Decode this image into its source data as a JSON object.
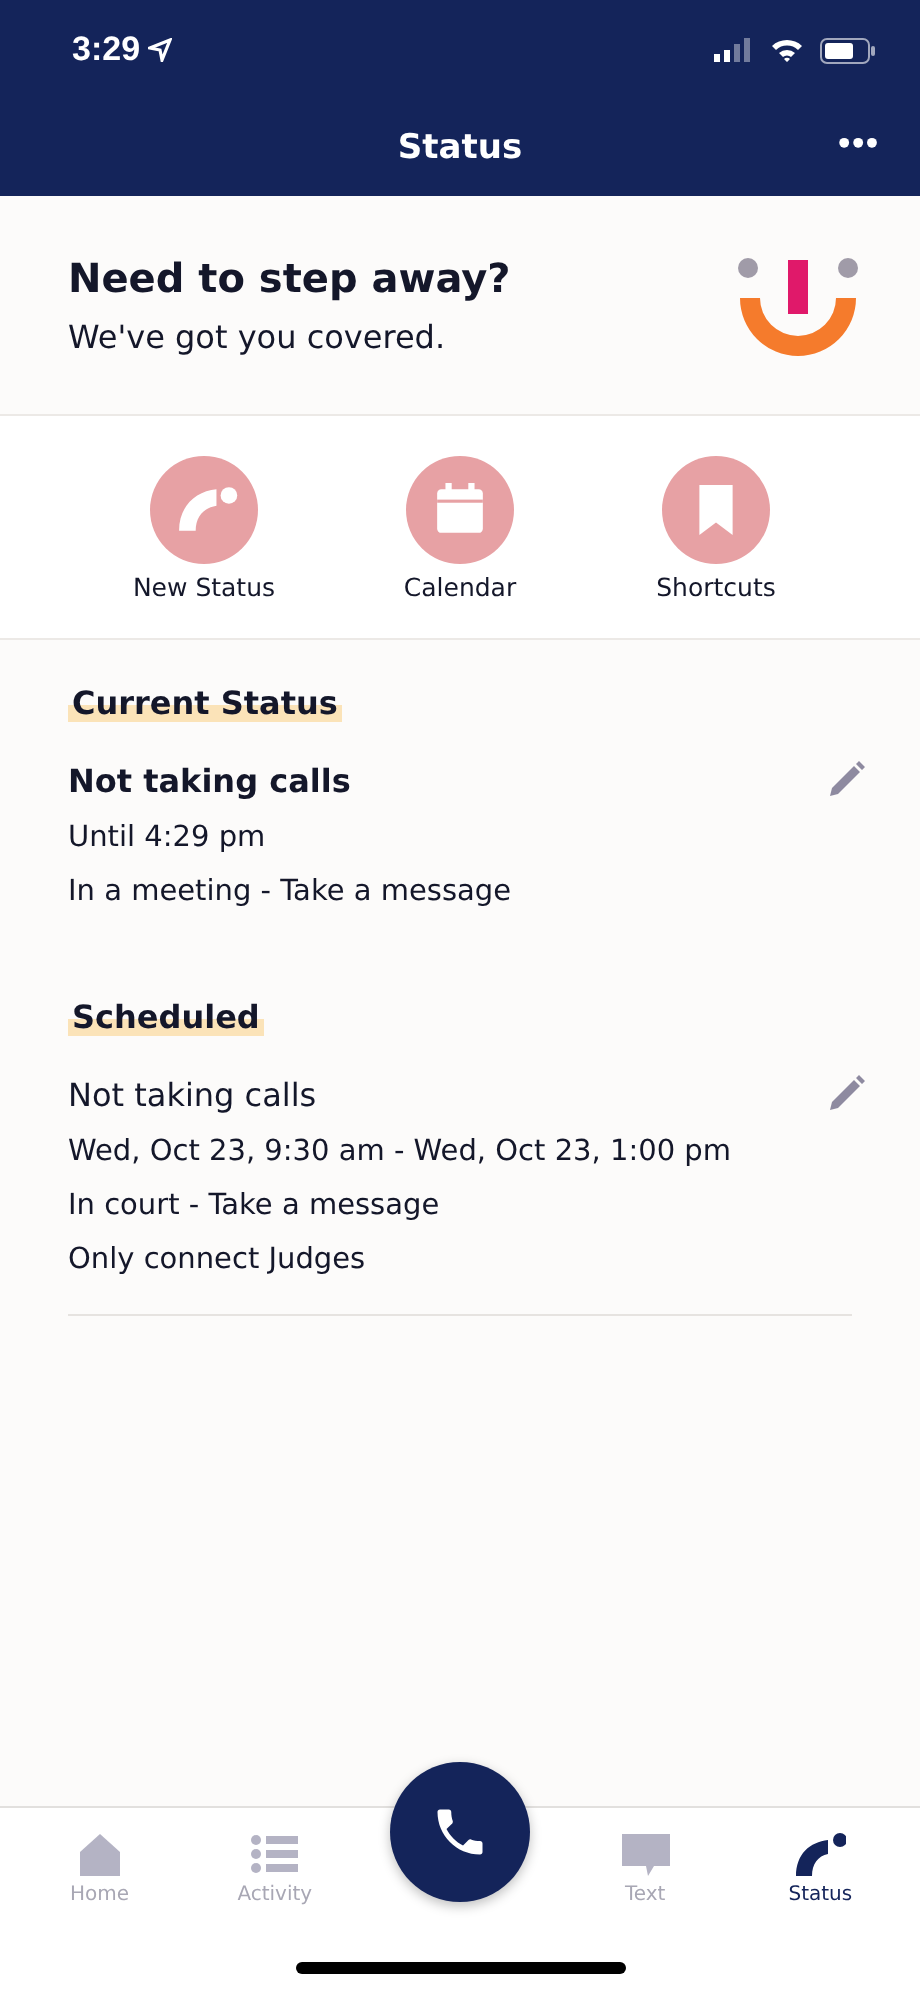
{
  "status_bar": {
    "time": "3:29"
  },
  "header": {
    "title": "Status",
    "menu": "•••"
  },
  "hero": {
    "title": "Need to step away?",
    "subtitle": "We've got you covered."
  },
  "actions": [
    {
      "kind": "status",
      "label": "New Status"
    },
    {
      "kind": "calendar",
      "label": "Calendar"
    },
    {
      "kind": "bookmark",
      "label": "Shortcuts"
    }
  ],
  "sections": [
    {
      "heading": "Current Status",
      "kind": "current",
      "title": "Not taking calls",
      "lines": [
        "Until 4:29 pm",
        "In a meeting - Take a message"
      ]
    },
    {
      "heading": "Scheduled",
      "kind": "scheduled",
      "title": "Not taking calls",
      "lines": [
        "Wed, Oct 23, 9:30 am - Wed, Oct 23, 1:00 pm",
        "In court - Take a message",
        "Only connect Judges"
      ]
    }
  ],
  "tabs": [
    {
      "kind": "home",
      "label": "Home",
      "selected": false
    },
    {
      "kind": "activity",
      "label": "Activity",
      "selected": false
    },
    {
      "kind": "call"
    },
    {
      "kind": "text",
      "label": "Text",
      "selected": false
    },
    {
      "kind": "status",
      "label": "Status",
      "selected": true
    }
  ]
}
